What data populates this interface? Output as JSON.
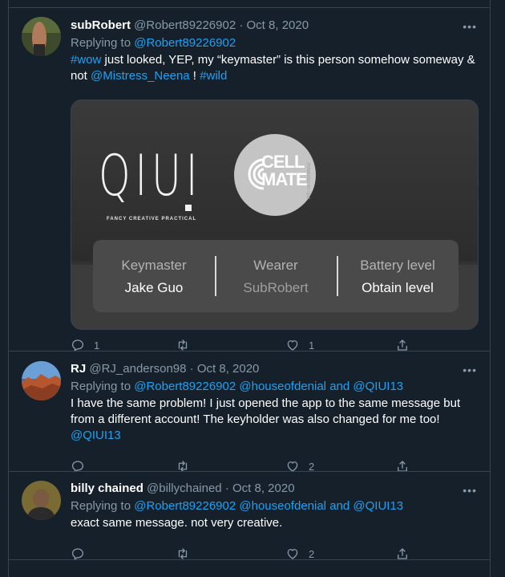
{
  "tweets": [
    {
      "display_name": "subRobert",
      "handle": "@Robert89226902",
      "separator": "·",
      "date": "Oct 8, 2020",
      "reply_prefix": "Replying to",
      "reply_handles": "@Robert89226902",
      "text_parts": {
        "hashtag1": "#wow",
        "mid1": " just looked, YEP, my “keymaster” is this person somehow someway & not ",
        "mention": "@Mistress_Neena",
        "mid2": " ! ",
        "hashtag2": "#wild"
      },
      "media": {
        "brand_left": "QIUI",
        "brand_left_tagline": "FANCY   CREATIVE   PRACTICAL",
        "brand_right_line1": "CELL",
        "brand_right_line2": "MATE",
        "brand_right_sub": "POWERED BY QIUI",
        "fields": [
          {
            "label": "Keymaster",
            "value": "Jake Guo"
          },
          {
            "label": "Wearer",
            "value": "SubRobert"
          },
          {
            "label": "Battery level",
            "value": "Obtain level"
          }
        ]
      },
      "reply_count": "1",
      "retweet_count": "",
      "like_count": "1",
      "more_label": "•••"
    },
    {
      "display_name": "RJ",
      "handle": "@RJ_anderson98",
      "separator": "·",
      "date": "Oct 8, 2020",
      "reply_prefix": "Replying to",
      "reply_handles": "@Robert89226902 @houseofdenial",
      "reply_and": "and",
      "reply_last": "@QIUI13",
      "text": "I have the same problem! I just opened the app to the same message but from a different account! The keyholder was also changed for me too!",
      "text_mention": "@QIUI13",
      "reply_count": "",
      "retweet_count": "",
      "like_count": "2",
      "more_label": "•••"
    },
    {
      "display_name": "billy chained",
      "handle": "@billychained",
      "separator": "·",
      "date": "Oct 8, 2020",
      "reply_prefix": "Replying to",
      "reply_handles": "@Robert89226902 @houseofdenial",
      "reply_and": "and",
      "reply_last": "@QIUI13",
      "text": "exact same message. not very creative.",
      "reply_count": "",
      "retweet_count": "",
      "like_count": "2",
      "more_label": "•••"
    }
  ],
  "colors": {
    "background": "#15202b",
    "border": "#38444d",
    "link": "#1da1f2",
    "muted": "#8899a6"
  }
}
